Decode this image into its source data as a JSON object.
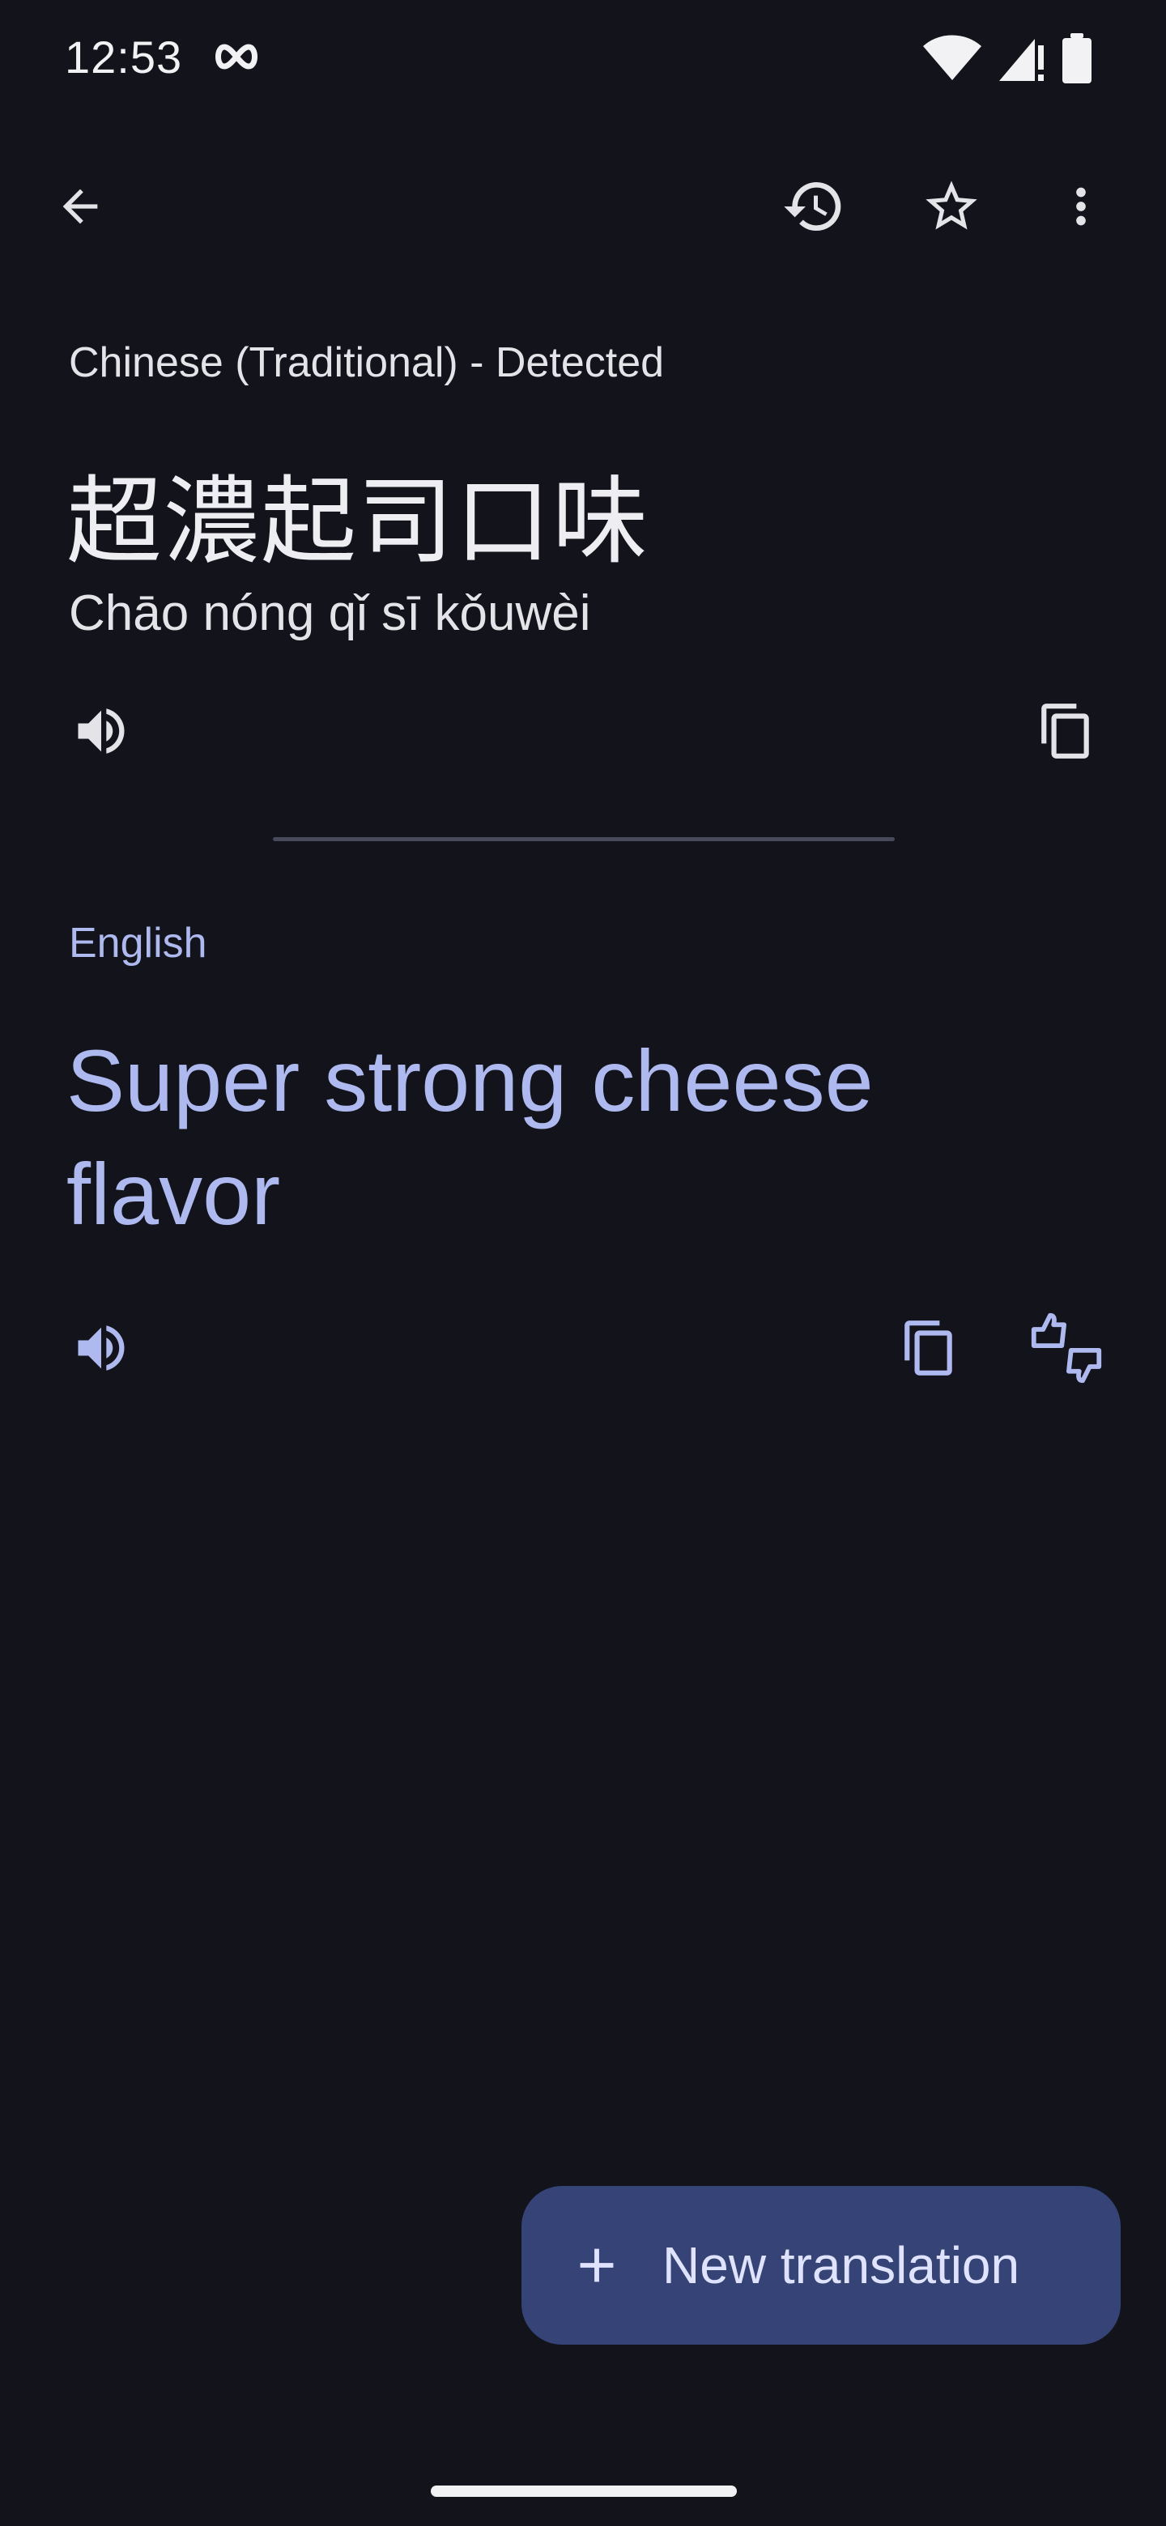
{
  "status_bar": {
    "time": "12:53",
    "icons": [
      "infinity-icon",
      "wifi-icon",
      "signal-icon",
      "battery-icon"
    ]
  },
  "toolbar": {
    "icons": [
      "back-arrow-icon",
      "history-icon",
      "star-icon",
      "more-vert-icon"
    ]
  },
  "source": {
    "language_label": "Chinese (Traditional) - Detected",
    "text": "超濃起司口味",
    "romanization": "Chāo nóng qǐ sī kǒuwèi",
    "icons": [
      "speaker-icon",
      "copy-icon"
    ]
  },
  "target": {
    "language_label": "English",
    "text": "Super strong cheese flavor",
    "icons": [
      "speaker-icon",
      "copy-icon",
      "feedback-icon"
    ]
  },
  "fab": {
    "label": "New translation",
    "icon": "plus-icon"
  },
  "colors": {
    "background": "#13141b",
    "text_primary": "#e3e3e8",
    "accent": "#aeb9f0",
    "fab_background": "#354377",
    "divider": "#484a5c"
  }
}
